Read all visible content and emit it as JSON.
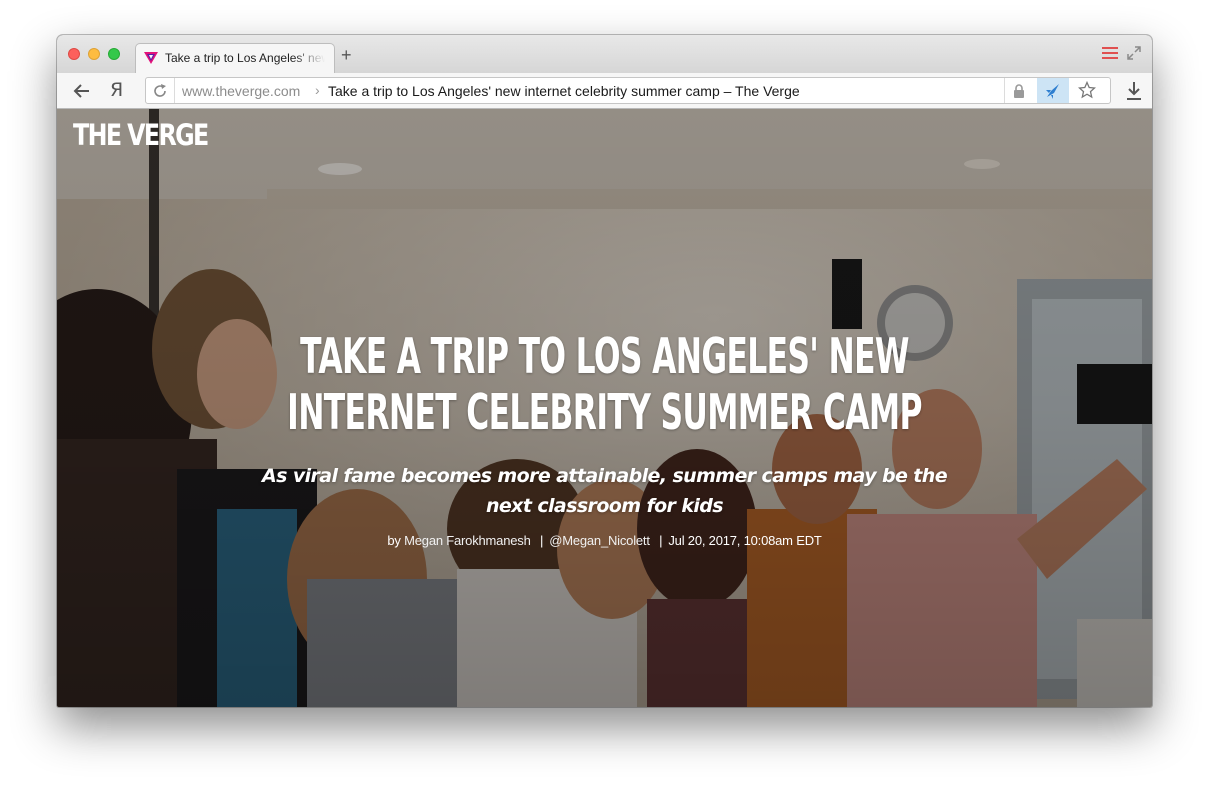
{
  "browser": {
    "tab": {
      "title": "Take a trip to Los Angeles' new internet celebrity summer camp – The Verge"
    },
    "new_tab_label": "+",
    "yandex_button_label": "Я",
    "address": {
      "domain": "www.theverge.com",
      "separator": "›",
      "page_title": "Take a trip to Los Angeles' new internet celebrity summer camp – The Verge"
    },
    "icons": [
      "close-window-icon",
      "minimize-window-icon",
      "zoom-window-icon",
      "verge-favicon-icon",
      "menu-icon",
      "fullscreen-icon",
      "back-arrow-icon",
      "reload-icon",
      "lock-icon",
      "turbo-rocket-icon",
      "bookmark-star-icon",
      "download-icon"
    ],
    "colors": {
      "accent_menu": "#e05050",
      "turbo_bg": "#cde4f5",
      "favicon": "#e2127a"
    }
  },
  "article": {
    "logo": "THE VERGE",
    "headline": "Take a trip to Los Angeles' new internet celebrity summer camp",
    "dek": "As viral fame becomes more attainable, summer camps may be the next classroom for kids",
    "byline": {
      "prefix": "by",
      "author": "Megan Farokhmanesh",
      "divider": "|",
      "twitter": "@Megan_Nicolett",
      "date": "Jul 20, 2017, 10:08am EDT"
    }
  }
}
